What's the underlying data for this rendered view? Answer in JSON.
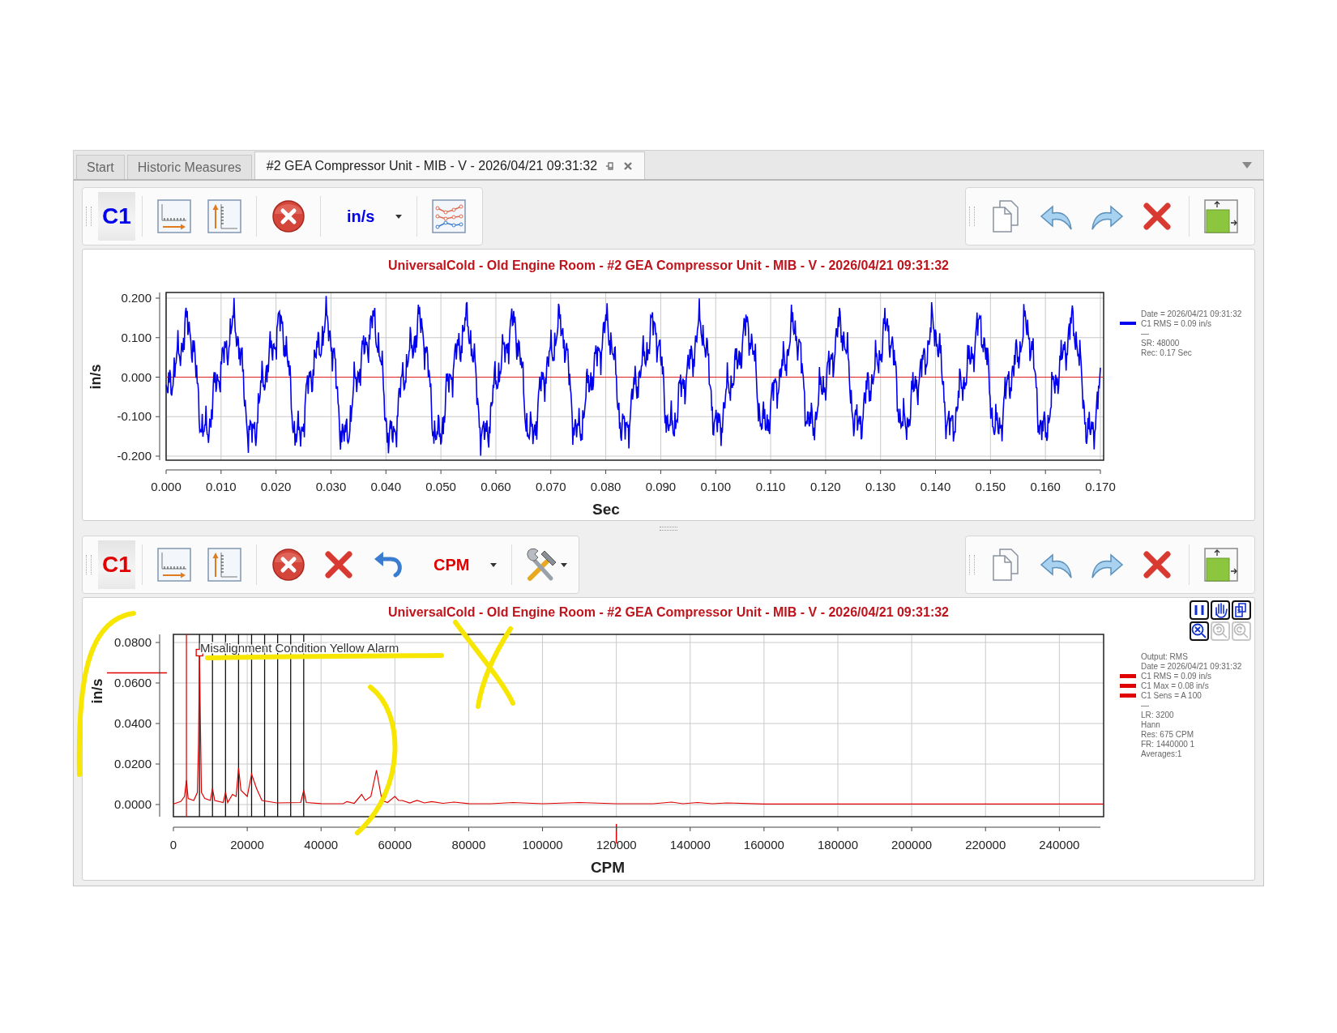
{
  "tabs": [
    {
      "label": "Start",
      "selected": false
    },
    {
      "label": "Historic Measures",
      "selected": false
    },
    {
      "label": "#2 GEA Compressor Unit - MIB - V - 2026/04/21 09:31:32",
      "selected": true,
      "pinnable": true,
      "closable": true
    }
  ],
  "panels": [
    {
      "color": "#0000ee",
      "toolbar": [
        {
          "kind": "channel",
          "label": "C1"
        },
        {
          "kind": "separator"
        },
        {
          "kind": "x-scale"
        },
        {
          "kind": "y-scale"
        },
        {
          "kind": "separator"
        },
        {
          "kind": "clear"
        },
        {
          "kind": "separator"
        },
        {
          "kind": "unit-dropdown",
          "label": "in/s"
        },
        {
          "kind": "separator"
        },
        {
          "kind": "series-options"
        }
      ],
      "right_toolbar": [
        {
          "kind": "copy"
        },
        {
          "kind": "back"
        },
        {
          "kind": "forward"
        },
        {
          "kind": "delete"
        },
        {
          "kind": "separator"
        },
        {
          "kind": "resize"
        }
      ],
      "title": "UniversalCold - Old Engine Room - #2 GEA Compressor Unit - MIB - V - 2026/04/21 09:31:32",
      "plot": {
        "kind": "waveform",
        "ylabel": "in/s",
        "xlabel": "Sec",
        "yticks": [
          "0.200",
          "0.100",
          "0.000",
          "-0.100",
          "-0.200"
        ],
        "xticks": [
          "0.000",
          "0.010",
          "0.020",
          "0.030",
          "0.040",
          "0.050",
          "0.060",
          "0.070",
          "0.080",
          "0.090",
          "0.100",
          "0.110",
          "0.120",
          "0.130",
          "0.140",
          "0.150",
          "0.160",
          "0.170"
        ]
      },
      "legend": [
        {
          "kind": "info",
          "text": "Date = 2026/04/21 09:31:32"
        },
        {
          "kind": "series",
          "text": "C1 RMS = 0.09 in/s"
        },
        {
          "kind": "info",
          "text": "—"
        },
        {
          "kind": "info",
          "text": "SR: 48000"
        },
        {
          "kind": "info",
          "text": "Rec: 0.17 Sec"
        }
      ]
    },
    {
      "color": "#e00000",
      "toolbar": [
        {
          "kind": "channel",
          "label": "C1"
        },
        {
          "kind": "separator"
        },
        {
          "kind": "x-scale"
        },
        {
          "kind": "y-scale"
        },
        {
          "kind": "separator"
        },
        {
          "kind": "clear"
        },
        {
          "kind": "delete"
        },
        {
          "kind": "undo"
        },
        {
          "kind": "unit-dropdown",
          "label": "CPM"
        },
        {
          "kind": "separator"
        },
        {
          "kind": "tools-dropdown"
        }
      ],
      "right_toolbar": [
        {
          "kind": "copy"
        },
        {
          "kind": "back"
        },
        {
          "kind": "forward"
        },
        {
          "kind": "delete"
        },
        {
          "kind": "separator"
        },
        {
          "kind": "resize"
        }
      ],
      "title": "UniversalCold - Old Engine Room - #2 GEA Compressor Unit - MIB - V - 2026/04/21 09:31:32",
      "chart_tools": [
        {
          "kind": "pause",
          "disabled": false
        },
        {
          "kind": "hand",
          "disabled": false
        },
        {
          "kind": "copy",
          "disabled": false
        },
        {
          "kind": "zoom-reset",
          "disabled": false
        },
        {
          "kind": "zoom-back",
          "disabled": true
        },
        {
          "kind": "zoom-forward",
          "disabled": true
        }
      ],
      "plot": {
        "kind": "spectrum",
        "annotation": "Misalignment Condition Yellow Alarm",
        "chart_data": {
          "type": "line",
          "xlabel": "CPM",
          "ylabel": "in/s",
          "xlim": [
            0,
            252000
          ],
          "ylim": [
            -0.006,
            0.084
          ],
          "x": [
            0,
            2000,
            3000,
            3530,
            4000,
            5500,
            6500,
            6800,
            7060,
            7300,
            7600,
            8500,
            10000,
            10590,
            11200,
            13500,
            14120,
            14700,
            16000,
            17000,
            17650,
            18300,
            20000,
            21180,
            22500,
            24000,
            28000,
            34500,
            35300,
            36000,
            40000,
            46000,
            47000,
            49000,
            51000,
            52000,
            53500,
            55000,
            56500,
            58000,
            60000,
            61000,
            62000,
            64000,
            66000,
            68000,
            70000,
            73000,
            76000,
            80000,
            86000,
            92000,
            100000,
            110000,
            120000,
            130000,
            135000,
            138000,
            142000,
            146000,
            150000,
            160000,
            180000,
            200000,
            220000,
            240000,
            252000
          ],
          "grid": true,
          "ref_lines": [
            {
              "axis": "x",
              "value": 3530,
              "color": "#d01010"
            },
            {
              "axis": "x",
              "value": 7060,
              "color": "#111111"
            },
            {
              "axis": "x",
              "value": 10590,
              "color": "#111111"
            },
            {
              "axis": "x",
              "value": 14120,
              "color": "#111111"
            },
            {
              "axis": "x",
              "value": 17650,
              "color": "#111111"
            },
            {
              "axis": "x",
              "value": 21180,
              "color": "#111111"
            },
            {
              "axis": "x",
              "value": 24710,
              "color": "#111111"
            },
            {
              "axis": "x",
              "value": 28240,
              "color": "#111111"
            },
            {
              "axis": "x",
              "value": 31770,
              "color": "#111111"
            },
            {
              "axis": "x",
              "value": 35300,
              "color": "#111111"
            }
          ],
          "series": [
            {
              "color": "#e00000",
              "values": [
                0.0003,
                0.0015,
                0.004,
                0.012,
                0.003,
                0.002,
                0.006,
                0.03,
                0.075,
                0.04,
                0.006,
                0.003,
                0.002,
                0.008,
                0.002,
                0.001,
                0.006,
                0.001,
                0.005,
                0.004,
                0.018,
                0.007,
                0.004,
                0.015,
                0.008,
                0.002,
                0.0008,
                0.001,
                0.007,
                0.001,
                0.0005,
                0.0004,
                0.0015,
                0.0006,
                0.005,
                0.002,
                0.004,
                0.017,
                0.002,
                0.001,
                0.004,
                0.002,
                0.002,
                0.0008,
                0.002,
                0.0008,
                0.0015,
                0.0006,
                0.0012,
                0.0005,
                0.0004,
                0.001,
                0.0004,
                0.001,
                0.0004,
                0.0004,
                0.0012,
                0.0004,
                0.001,
                0.0004,
                0.0008,
                0.0003,
                0.0003,
                0.0003,
                0.0003,
                0.0003,
                0.0003
              ]
            }
          ],
          "xticks": [
            0,
            20000,
            40000,
            60000,
            80000,
            100000,
            120000,
            140000,
            160000,
            180000,
            200000,
            220000,
            240000
          ],
          "yticks": [
            {
              "value": 0.08,
              "label": "0.0800"
            },
            {
              "value": 0.06,
              "label": "0.0600"
            },
            {
              "value": 0.04,
              "label": "0.0400"
            },
            {
              "value": 0.02,
              "label": "0.0200"
            },
            {
              "value": 0,
              "label": "0.0000"
            }
          ]
        }
      },
      "legend": [
        {
          "kind": "info",
          "text": "Output: RMS"
        },
        {
          "kind": "info",
          "text": "Date = 2026/04/21 09:31:32"
        },
        {
          "kind": "series",
          "text": "C1 RMS = 0.09 in/s"
        },
        {
          "kind": "series",
          "text": "C1 Max = 0.08 in/s"
        },
        {
          "kind": "series",
          "text": "C1 Sens = A 100"
        },
        {
          "kind": "info",
          "text": "—"
        },
        {
          "kind": "info",
          "text": "LR: 3200"
        },
        {
          "kind": "info",
          "text": "Hann"
        },
        {
          "kind": "info",
          "text": "Res: 675 CPM"
        },
        {
          "kind": "info",
          "text": "FR: 1440000 1"
        },
        {
          "kind": "info",
          "text": "Averages:1"
        }
      ]
    }
  ]
}
